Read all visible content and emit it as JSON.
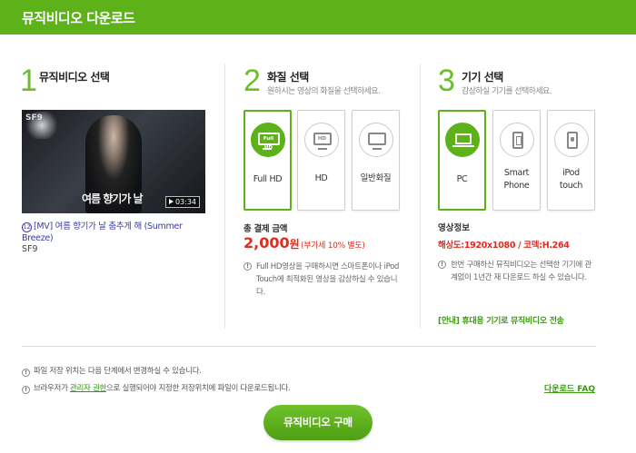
{
  "header": {
    "title": "뮤직비디오 다운로드"
  },
  "steps": [
    {
      "number": "1",
      "title": "뮤직비디오 선택",
      "subtitle": ""
    },
    {
      "number": "2",
      "title": "화질 선택",
      "subtitle": "원하시는 영상의 화질을 선택하세요."
    },
    {
      "number": "3",
      "title": "기기 선택",
      "subtitle": "감상하실 기기를 선택하세요."
    }
  ],
  "video": {
    "age_rating": "12",
    "title": "[MV] 여름 향기가 날 춤추게 해 (Summer Breeze)",
    "artist": "SF9",
    "thumb_text": "여름 향기가 날",
    "thumb_logo": "SF9",
    "duration": "03:34"
  },
  "quality_options": [
    {
      "label": "Full HD",
      "icon": "fullhd-monitor-icon",
      "icon_text": "Full HD",
      "selected": true
    },
    {
      "label": "HD",
      "icon": "hd-monitor-icon",
      "icon_text": "HD",
      "selected": false
    },
    {
      "label": "일반화질",
      "icon": "monitor-icon",
      "icon_text": "",
      "selected": false
    }
  ],
  "device_options": [
    {
      "label": "PC",
      "icon": "laptop-icon",
      "selected": true
    },
    {
      "label": "Smart Phone",
      "line1": "Smart",
      "line2": "Phone",
      "icon": "smartphone-icon",
      "selected": false
    },
    {
      "label": "iPod touch",
      "line1": "iPod",
      "line2": "touch",
      "icon": "ipod-icon",
      "selected": false
    }
  ],
  "payment": {
    "total_label": "총 결제 금액",
    "price": "2,000",
    "price_unit": "원",
    "vat_note": "(부가세 10% 별도)"
  },
  "quality_note": "Full HD영상을 구매하시면 스마트폰이나 iPod Touch에 최적화된 영상을 감상하실 수 있습니다.",
  "device_info": {
    "label": "영상정보",
    "resolution_text": "해상도:1920x1080 / 코덱:H.264",
    "note": "한번 구매하신 뮤직비디오는 선택한 기기에 관계없이 1년간 재 다운로드 하실 수 있습니다.",
    "notice_link": "[안내] 휴대용 기기로 뮤직비디오 전송"
  },
  "bottom_notes": {
    "note1": "파일 저장 위치는 다음 단계에서 변경하실 수 있습니다.",
    "note2_pre": "브라우저가 ",
    "note2_link": "관리자 권한",
    "note2_post": "으로 실행되어야 지정한 저장위치에 파일이 다운로드됩니다.",
    "faq_link": "다운로드 FAQ"
  },
  "buy_button": "뮤직비디오 구매",
  "colors": {
    "brand_green": "#5db21a",
    "price_red": "#e02b1e",
    "link_green": "#3a9a10"
  }
}
